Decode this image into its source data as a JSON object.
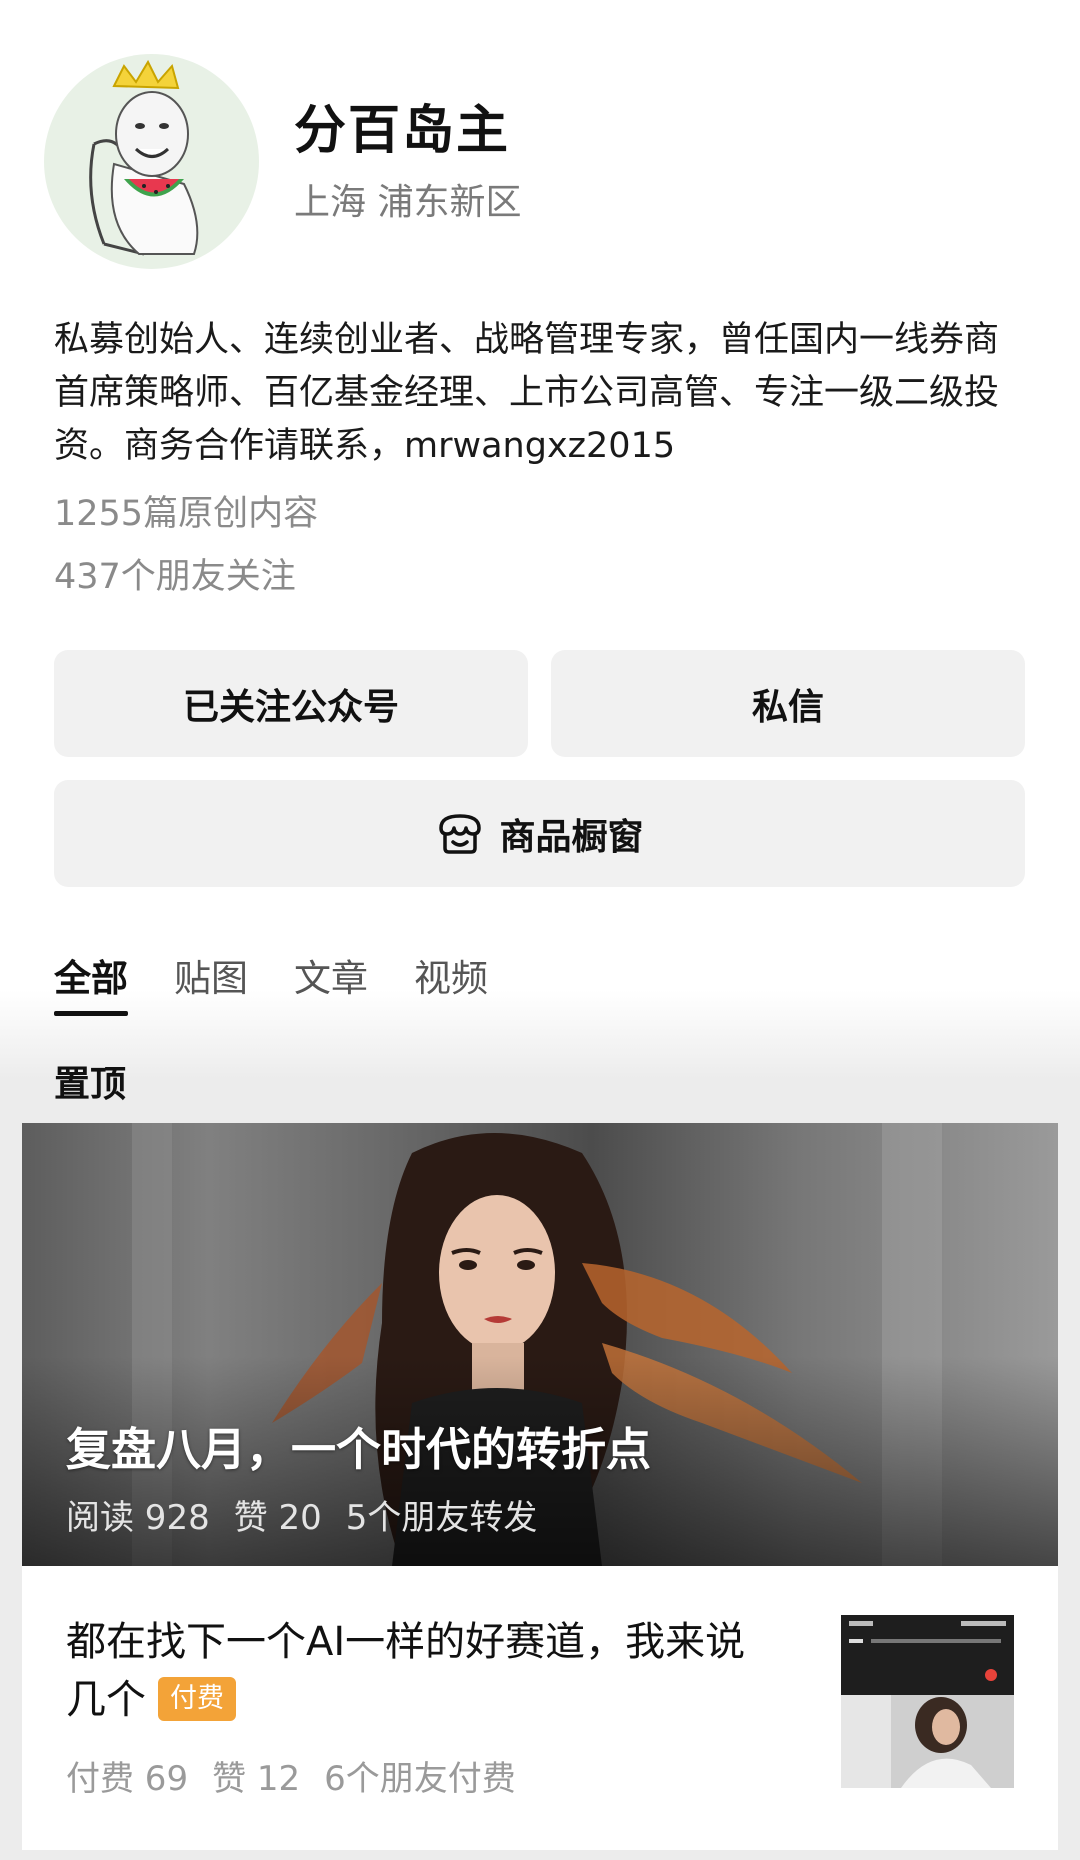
{
  "profile": {
    "name": "分百岛主",
    "location": "上海 浦东新区",
    "bio": "私募创始人、连续创业者、战略管理专家，曾任国内一线券商首席策略师、百亿基金经理、上市公司高管、专注一级二级投资。商务合作请联系，mrwangxz2015",
    "original_count": "1255篇原创内容",
    "friends_follow": "437个朋友关注"
  },
  "buttons": {
    "followed": "已关注公众号",
    "message": "私信",
    "shop": "商品橱窗"
  },
  "tabs": [
    {
      "label": "全部",
      "active": true
    },
    {
      "label": "贴图",
      "active": false
    },
    {
      "label": "文章",
      "active": false
    },
    {
      "label": "视频",
      "active": false
    }
  ],
  "pinned_label": "置顶",
  "pinned_post": {
    "title": "复盘八月，一个时代的转折点",
    "reads": "阅读 928",
    "likes": "赞 20",
    "shares": "5个朋友转发"
  },
  "article": {
    "title": "都在找下一个AI一样的好赛道，我来说几个",
    "tag": "付费",
    "paid": "付费 69",
    "likes": "赞 12",
    "friends_paid": "6个朋友付费"
  },
  "icons": {
    "shop": "storefront-icon",
    "avatar": "meme-avatar-image",
    "hero": "cover-photo-image",
    "thumb": "article-thumbnail-image"
  },
  "colors": {
    "paid_tag": "#f3a338",
    "button_bg": "#f1f1f1"
  }
}
